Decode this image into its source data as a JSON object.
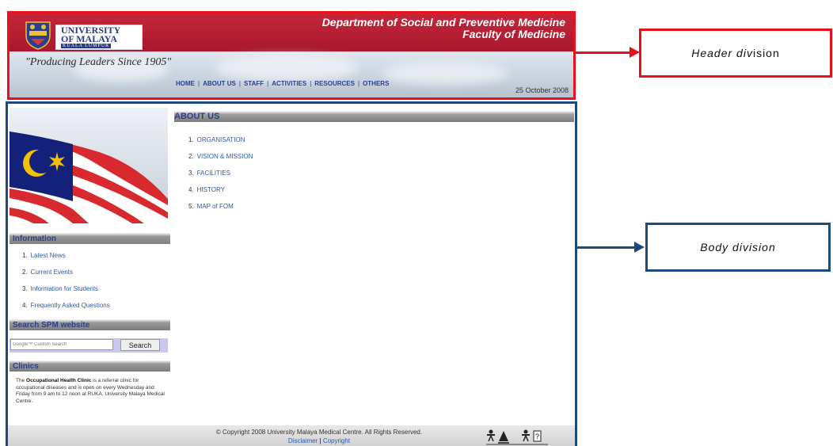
{
  "header": {
    "university_name": "UNIVERSITY\nOF MALAYA",
    "university_location": "KUALA LUMPUR",
    "slogan": "\"Producing Leaders Since 1905\"",
    "dept_line1": "Department of Social and Preventive Medicine",
    "dept_line2": "Faculty of Medicine",
    "nav": [
      "HOME",
      "ABOUT US",
      "STAFF",
      "ACTIVITIES",
      "RESOURCES",
      "OTHERS"
    ],
    "nav_separator": "|",
    "date": "25 October 2008",
    "colors": {
      "banner_red": "#b01e32",
      "nav_text": "#2c3e8c"
    }
  },
  "annotations": {
    "header_label_italic": "Header div",
    "header_label_rest": "ision",
    "body_label": "Body division",
    "header_color": "#e8101a",
    "body_color": "#1f4a7c"
  },
  "sidebar": {
    "information_title": "Information",
    "information_items": [
      {
        "num": "1.",
        "label": "Latest News"
      },
      {
        "num": "2.",
        "label": "Current Events"
      },
      {
        "num": "3.",
        "label": "Information for Students"
      },
      {
        "num": "4.",
        "label": "Frequently Asked Questions"
      }
    ],
    "search_title": "Search SPM website",
    "search_placeholder": "Google™ Custom Search",
    "search_button": "Search",
    "clinics_title": "Clinics",
    "clinic_prefix": "The ",
    "clinic_bold": "Occupational Health Clinic",
    "clinic_suffix": " is a referral clinic for occupational diseases and is open on every Wednesday and Friday from 9 am to 12 noon at RUKA, University Malaya Medical Centre."
  },
  "main": {
    "about_title": "ABOUT US",
    "about_items": [
      {
        "num": "1.",
        "label": "ORGANISATION"
      },
      {
        "num": "2.",
        "label": "VISION & MISSION"
      },
      {
        "num": "3.",
        "label": "FACILITIES"
      },
      {
        "num": "4.",
        "label": "HISTORY"
      },
      {
        "num": "5.",
        "label": "MAP of FOM"
      }
    ]
  },
  "footer": {
    "copyright": "© Copyright 2008 University Malaya Medical Centre. All Rights Reserved.",
    "disclaimer": "Disclaimer",
    "sep": "|",
    "copyright_link": "Copyright",
    "badge_icons": [
      "accessibility-icon",
      "w3c-icon",
      "help-icon"
    ]
  }
}
